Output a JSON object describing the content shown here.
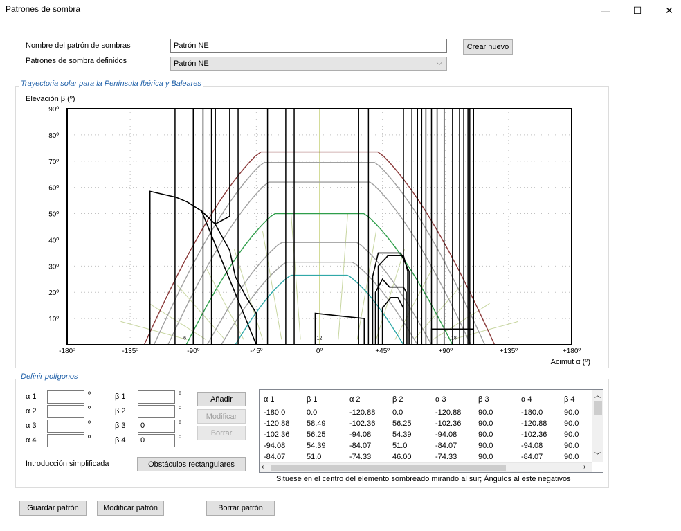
{
  "window": {
    "title": "Patrones de sombra",
    "minimize": "—",
    "maximize": "☐",
    "close": "✕"
  },
  "header": {
    "name_label": "Nombre del patrón de sombras",
    "name_value": "Patrón NE",
    "defined_label": "Patrones de sombra definidos",
    "defined_value": "Patrón NE",
    "create_new": "Crear nuevo"
  },
  "chart_group": {
    "legend": "Trayectoria solar para la Península Ibérica y Baleares"
  },
  "chart_data": {
    "type": "line",
    "ylabel": "Elevación β (º)",
    "xlabel": "Acimut α (º)",
    "xlim": [
      -180,
      180
    ],
    "ylim": [
      0,
      90
    ],
    "x_ticks": [
      -180,
      -135,
      -90,
      -45,
      0,
      45,
      90,
      135,
      180
    ],
    "x_tick_labels": [
      "-180º",
      "-135º",
      "-90º",
      "-45º",
      "0º",
      "+45º",
      "+90º",
      "+135º",
      "+180º"
    ],
    "y_ticks": [
      10,
      20,
      30,
      40,
      50,
      60,
      70,
      80,
      90
    ],
    "y_tick_labels": [
      "10º",
      "20º",
      "30º",
      "40º",
      "50º",
      "60º",
      "70º",
      "80º",
      "90º"
    ],
    "hour_labels": [
      {
        "x": -96,
        "y": 2,
        "text": "6"
      },
      {
        "x": 0,
        "y": 2,
        "text": "12"
      },
      {
        "x": 96,
        "y": 2,
        "text": "18"
      }
    ],
    "sun_paths": [
      {
        "name": "",
        "color": "#8b3a3a",
        "max_elev": 73.5,
        "half_width": 125
      },
      {
        "name": "",
        "color": "#a0a0a0",
        "max_elev": 69.5,
        "half_width": 118
      },
      {
        "name": "",
        "color": "#a0a0a0",
        "max_elev": 62,
        "half_width": 108
      },
      {
        "name": "",
        "color": "#2e9e4a",
        "max_elev": 50,
        "half_width": 95
      },
      {
        "name": "",
        "color": "#a0a0a0",
        "max_elev": 39,
        "half_width": 80
      },
      {
        "name": "",
        "color": "#a0a0a0",
        "max_elev": 31.5,
        "half_width": 70
      },
      {
        "name": "",
        "color": "#30a8a8",
        "max_elev": 26.5,
        "half_width": 60
      }
    ],
    "obstacle_polygons": [
      [
        [
          -120.88,
          0
        ],
        [
          -120.88,
          58.49
        ],
        [
          -102.36,
          56.25
        ],
        [
          -94.08,
          54.39
        ],
        [
          -84.07,
          51.0
        ],
        [
          -74.33,
          46.0
        ],
        [
          -74.33,
          90
        ],
        [
          -180,
          90
        ],
        [
          -180,
          0
        ]
      ],
      [
        [
          -74.33,
          46.0
        ],
        [
          -64,
          49
        ],
        [
          -64,
          90
        ],
        [
          -74.33,
          90
        ]
      ],
      [
        [
          -84.07,
          51
        ],
        [
          -74.33,
          46
        ],
        [
          -64,
          36
        ],
        [
          -60,
          26
        ],
        [
          -52,
          18
        ],
        [
          -45,
          12
        ],
        [
          -45,
          0
        ]
      ],
      [
        [
          -3,
          12
        ],
        [
          -3,
          0
        ],
        [
          32,
          0
        ],
        [
          32,
          10
        ]
      ],
      [
        [
          38,
          26
        ],
        [
          42,
          35
        ],
        [
          58,
          35
        ],
        [
          64,
          28
        ],
        [
          64,
          0
        ],
        [
          38,
          0
        ]
      ],
      [
        [
          42,
          30
        ],
        [
          49,
          34
        ],
        [
          60,
          34
        ],
        [
          63,
          28
        ],
        [
          63,
          0
        ],
        [
          42,
          0
        ]
      ],
      [
        [
          40,
          20
        ],
        [
          45,
          25
        ],
        [
          50,
          22
        ],
        [
          60,
          22
        ],
        [
          62,
          20
        ],
        [
          62,
          0
        ],
        [
          40,
          0
        ]
      ],
      [
        [
          45,
          14
        ],
        [
          51,
          18
        ],
        [
          56,
          18
        ],
        [
          60,
          14
        ],
        [
          60,
          0
        ],
        [
          45,
          0
        ]
      ],
      [
        [
          80,
          6
        ],
        [
          80,
          0
        ],
        [
          110,
          0
        ],
        [
          110,
          6
        ]
      ]
    ],
    "obstacle_vlines": [
      -103,
      -90,
      -83,
      -77,
      -58,
      -37,
      -24,
      -18,
      28,
      35,
      60,
      66,
      70,
      73,
      76,
      80,
      84,
      89,
      95,
      100,
      103,
      106,
      107,
      108,
      110
    ]
  },
  "polygons_group": {
    "legend": "Definir polígonos",
    "alpha_labels": [
      "α 1",
      "α 2",
      "α 3",
      "α 4"
    ],
    "beta_labels": [
      "β 1",
      "β 2",
      "β 3",
      "β 4"
    ],
    "alpha_values": [
      "",
      "",
      "",
      ""
    ],
    "beta_values": [
      "",
      "",
      "0",
      "0"
    ],
    "degree": "º",
    "add": "Añadir",
    "modify": "Modificar",
    "delete": "Borrar",
    "simplified_label": "Introducción simplificada",
    "rect_obstacles": "Obstáculos rectangulares",
    "table": {
      "headers": [
        "α 1",
        "β 1",
        "α 2",
        "β 2",
        "α 3",
        "β 3",
        "α 4",
        "β 4"
      ],
      "rows": [
        [
          "-180.0",
          "0.0",
          "-120.88",
          "0.0",
          "-120.88",
          "90.0",
          "-180.0",
          "90.0"
        ],
        [
          "-120.88",
          "58.49",
          "-102.36",
          "56.25",
          "-102.36",
          "90.0",
          "-120.88",
          "90.0"
        ],
        [
          "-102.36",
          "56.25",
          "-94.08",
          "54.39",
          "-94.08",
          "90.0",
          "-102.36",
          "90.0"
        ],
        [
          "-94.08",
          "54.39",
          "-84.07",
          "51.0",
          "-84.07",
          "90.0",
          "-94.08",
          "90.0"
        ],
        [
          "-84.07",
          "51.0",
          "-74.33",
          "46.00",
          "-74.33",
          "90.0",
          "-84.07",
          "90.0"
        ]
      ]
    },
    "hint": "Sitúese en el centro del elemento sombreado mirando al sur; Ángulos al este negativos"
  },
  "footer": {
    "save": "Guardar patrón",
    "modify": "Modificar patrón",
    "delete": "Borrar patrón"
  }
}
